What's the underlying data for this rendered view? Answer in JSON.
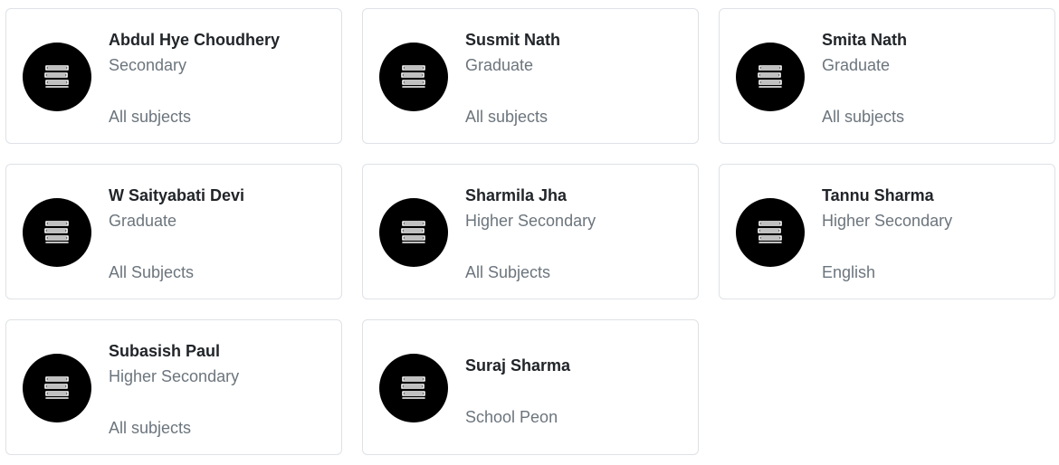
{
  "cards": [
    {
      "name": "Abdul Hye Choudhery",
      "qualification": "Secondary",
      "subjects": "All subjects",
      "icon": "books-icon"
    },
    {
      "name": "Susmit Nath",
      "qualification": "Graduate",
      "subjects": "All subjects",
      "icon": "books-icon"
    },
    {
      "name": "Smita Nath",
      "qualification": "Graduate",
      "subjects": "All subjects",
      "icon": "books-icon"
    },
    {
      "name": "W Saityabati Devi",
      "qualification": "Graduate",
      "subjects": "All Subjects",
      "icon": "books-icon"
    },
    {
      "name": "Sharmila Jha",
      "qualification": "Higher Secondary",
      "subjects": "All Subjects",
      "icon": "books-icon"
    },
    {
      "name": "Tannu Sharma",
      "qualification": "Higher Secondary",
      "subjects": "English",
      "icon": "books-icon"
    },
    {
      "name": "Subasish Paul",
      "qualification": "Higher Secondary",
      "subjects": "All subjects",
      "icon": "books-icon"
    },
    {
      "name": "Suraj Sharma",
      "qualification": "",
      "subjects": "School Peon",
      "icon": "books-icon"
    }
  ],
  "colors": {
    "avatar_bg": "#000000",
    "name_text": "#212529",
    "muted_text": "#6c757d",
    "card_border": "#dee2e6"
  }
}
